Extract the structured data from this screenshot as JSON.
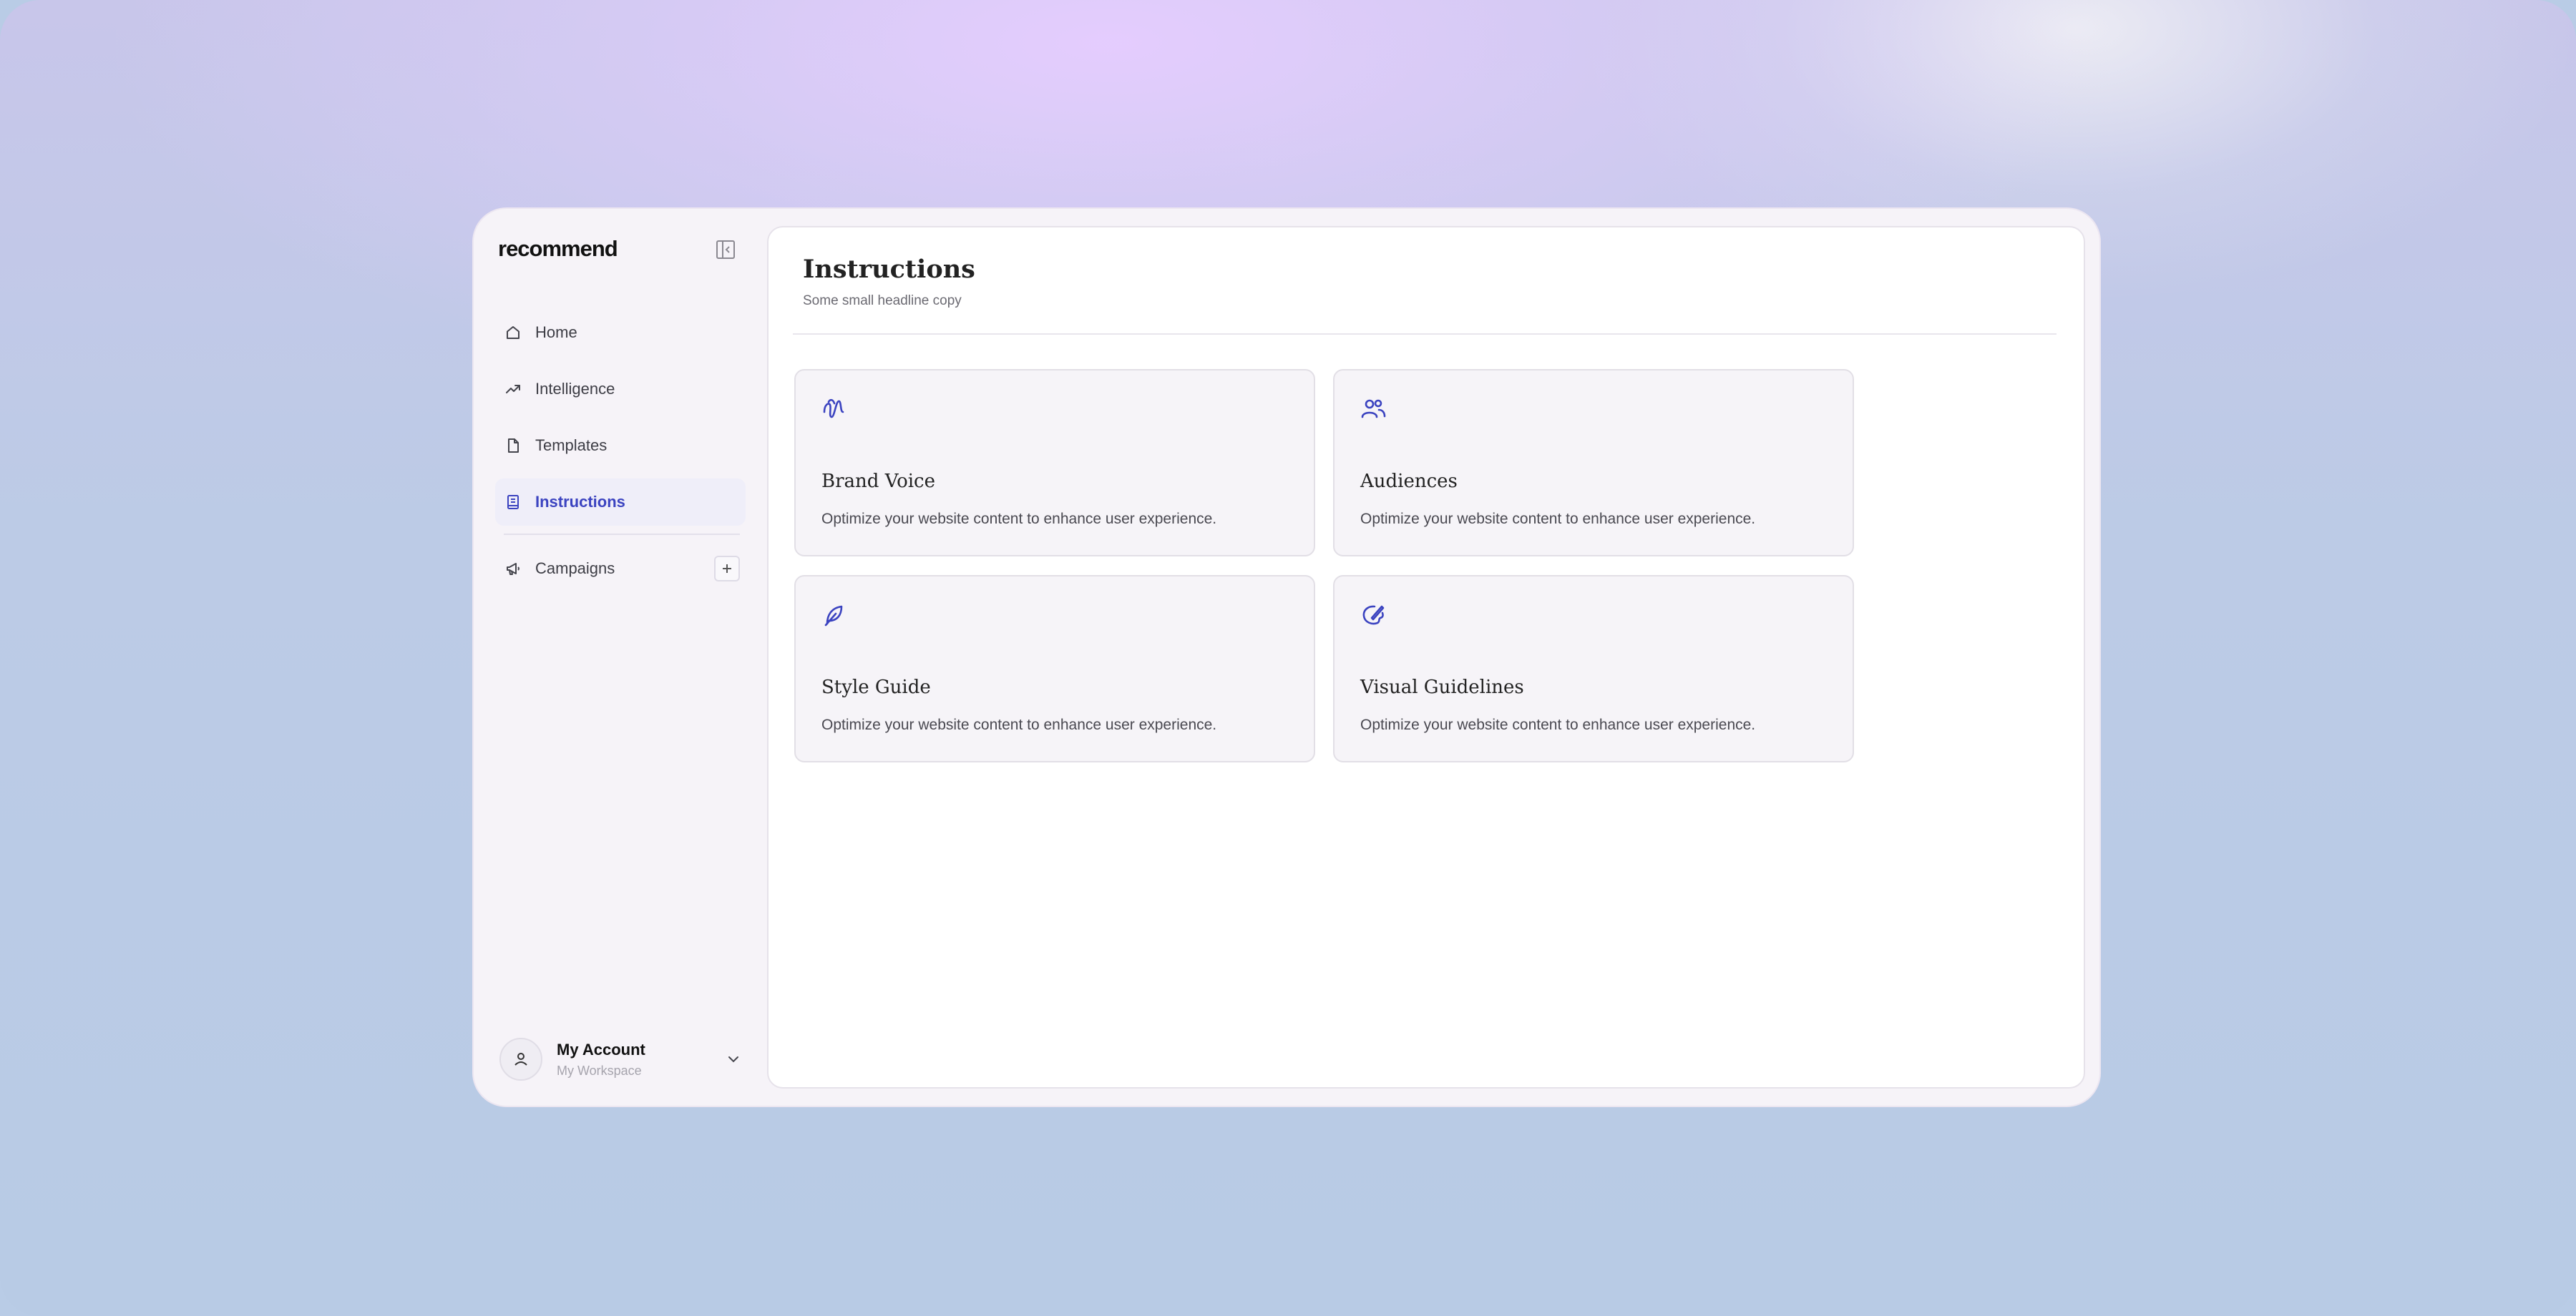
{
  "app": {
    "logo": "recommend",
    "accent_color": "#3b43c0"
  },
  "sidebar": {
    "items": [
      {
        "label": "Home",
        "icon": "home-icon"
      },
      {
        "label": "Intelligence",
        "icon": "trending-up-icon"
      },
      {
        "label": "Templates",
        "icon": "file-icon"
      },
      {
        "label": "Instructions",
        "icon": "book-icon",
        "active": true
      },
      {
        "label": "Campaigns",
        "icon": "megaphone-icon"
      }
    ],
    "account": {
      "name": "My Account",
      "workspace": "My Workspace"
    }
  },
  "main": {
    "title": "Instructions",
    "subtitle": "Some small headline copy",
    "cards": [
      {
        "title": "Brand Voice",
        "description": "Optimize your website content to enhance user experience.",
        "icon": "waveform-icon"
      },
      {
        "title": "Audiences",
        "description": "Optimize your website content to enhance user experience.",
        "icon": "users-icon"
      },
      {
        "title": "Style Guide",
        "description": "Optimize your website content to enhance user experience.",
        "icon": "feather-icon"
      },
      {
        "title": "Visual Guidelines",
        "description": "Optimize your website content to enhance user experience.",
        "icon": "palette-icon"
      }
    ]
  }
}
